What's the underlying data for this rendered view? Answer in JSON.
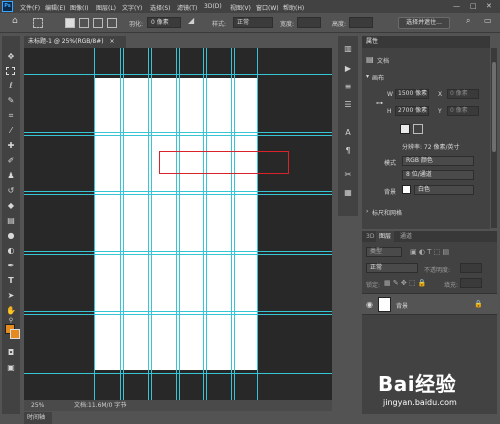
{
  "app": {
    "logo_text": "Ps"
  },
  "menu": {
    "items": [
      "文件(F)",
      "编辑(E)",
      "图像(I)",
      "图层(L)",
      "文字(Y)",
      "选择(S)",
      "滤镜(T)",
      "3D(D)",
      "视图(V)",
      "窗口(W)",
      "帮助(H)"
    ]
  },
  "window_controls": {
    "minimize": "—",
    "maximize": "□",
    "close": "✕"
  },
  "options_bar": {
    "feather_label": "羽化:",
    "feather_value": "0 像素",
    "style_label": "样式:",
    "style_value": "正常",
    "width_label": "宽度:",
    "height_label": "高度:",
    "select_mask_button": "选择并遮住..."
  },
  "document": {
    "tab_title": "未标题-1 @ 25%(RGB/8#)",
    "tab_close": "×",
    "zoom_status": "25%",
    "doc_status": "文档:11.6M/0 字节"
  },
  "timeline_tab": "时间轴",
  "properties_panel": {
    "tab": "属性",
    "doc_label": "文档",
    "canvas_section": "画布",
    "w_label": "W",
    "w_value": "1500 像素",
    "h_label": "H",
    "h_value": "2700 像素",
    "x_label": "X",
    "x_placeholder": "0 像素",
    "y_label": "Y",
    "y_placeholder": "0 像素",
    "resolution": "分辨率: 72 像素/英寸",
    "mode_label": "模式",
    "mode_value": "RGB 颜色",
    "depth_value": "8 位/通道",
    "bg_label": "背景",
    "bg_value": "白色",
    "rulers_section": "标尺和网格"
  },
  "layers_panel": {
    "tabs": [
      "3D",
      "图层",
      "通道"
    ],
    "search_placeholder": "类型",
    "blend_mode": "正常",
    "opacity_label": "不透明度:",
    "lock_label": "锁定:",
    "fill_label": "填充:",
    "layer_name": "背景"
  },
  "watermark": {
    "brand": "Bai经验",
    "url": "jingyan.baidu.com"
  },
  "colors": {
    "foreground": "#e58a1f",
    "background": "#e58a1f",
    "guide": "#37c5d6",
    "highlight_rect": "#d8232a",
    "canvas_bg": "#282828"
  }
}
